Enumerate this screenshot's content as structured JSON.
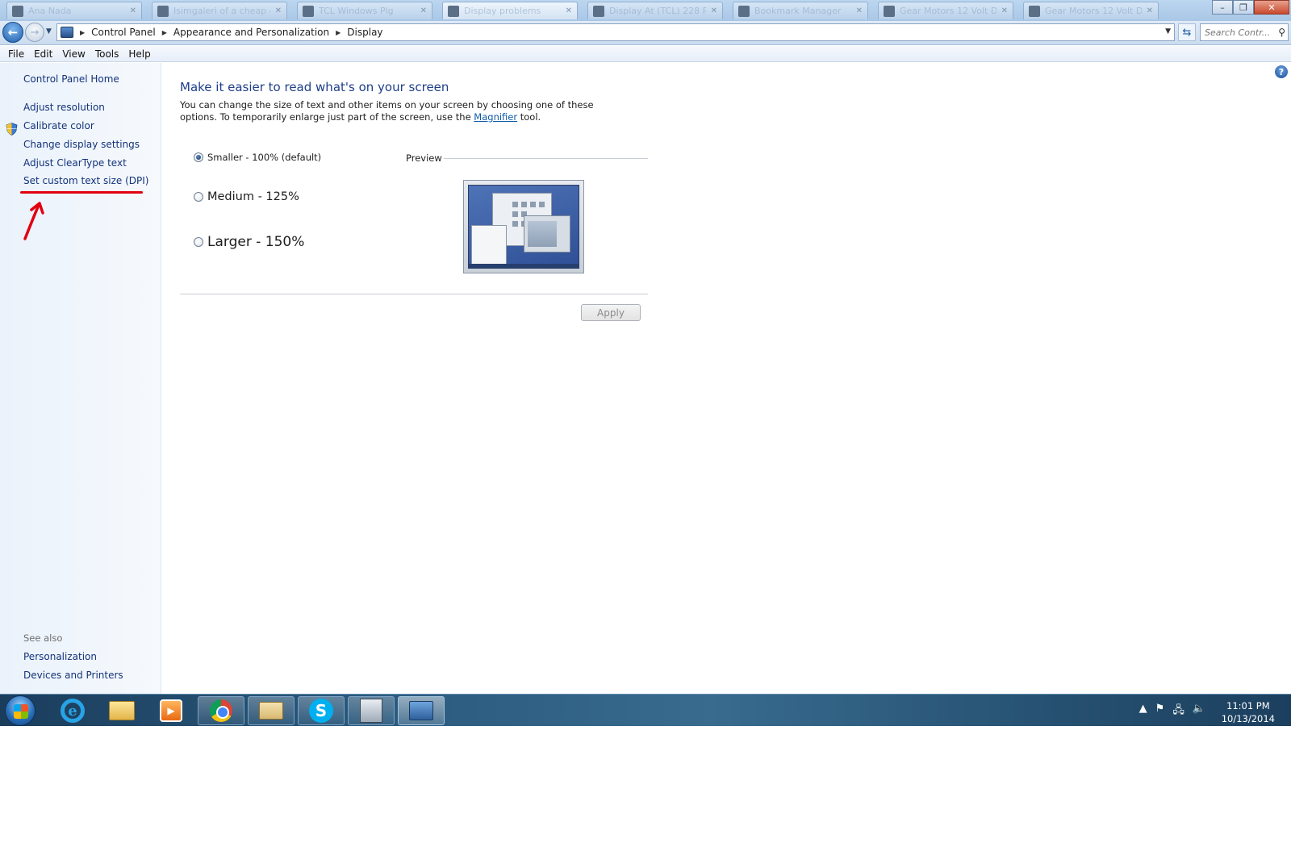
{
  "window": {
    "tabs": [
      {
        "label": "Ana Nada"
      },
      {
        "label": "Isimgaleri of a cheap da"
      },
      {
        "label": "TCL Windows Plg"
      },
      {
        "label": "Display problems"
      },
      {
        "label": "Display At (TCL) 228 P"
      },
      {
        "label": "Bookmark Manager"
      },
      {
        "label": "Gear Motors 12 Volt Dc"
      },
      {
        "label": "Gear Motors 12 Volt Dc"
      }
    ],
    "minimize": "–",
    "maximize": "❐",
    "close": "✕"
  },
  "address": {
    "back": "←",
    "forward": "→",
    "crumbs": [
      "Control Panel",
      "Appearance and Personalization",
      "Display"
    ],
    "search_placeholder": "Search Contr...",
    "search_icon": "⚲",
    "refresh_icon": "⇆"
  },
  "menu": [
    "File",
    "Edit",
    "View",
    "Tools",
    "Help"
  ],
  "sidebar": {
    "home": "Control Panel Home",
    "links": [
      "Adjust resolution",
      "Calibrate color",
      "Change display settings",
      "Adjust ClearType text",
      "Set custom text size (DPI)"
    ],
    "see_also_title": "See also",
    "see_also": [
      "Personalization",
      "Devices and Printers"
    ]
  },
  "content": {
    "help": "?",
    "heading": "Make it easier to read what's on your screen",
    "desc_pre": "You can change the size of text and other items on your screen by choosing one of these options. To temporarily enlarge just part of the screen, use the ",
    "desc_link": "Magnifier",
    "desc_post": " tool.",
    "options": [
      {
        "label": "Smaller - 100% (default)",
        "checked": true
      },
      {
        "label": "Medium - 125%",
        "checked": false
      },
      {
        "label": "Larger - 150%",
        "checked": false
      }
    ],
    "preview_label": "Preview",
    "apply": "Apply"
  },
  "taskbar": {
    "skype_letter": "S",
    "tray_icons": [
      "▲",
      "⚑",
      "🖧",
      "🔈"
    ],
    "time": "11:01 PM",
    "date": "10/13/2014"
  },
  "colors": {
    "link": "#14337a",
    "heading": "#1e3e8a",
    "annotation": "#e20010"
  }
}
